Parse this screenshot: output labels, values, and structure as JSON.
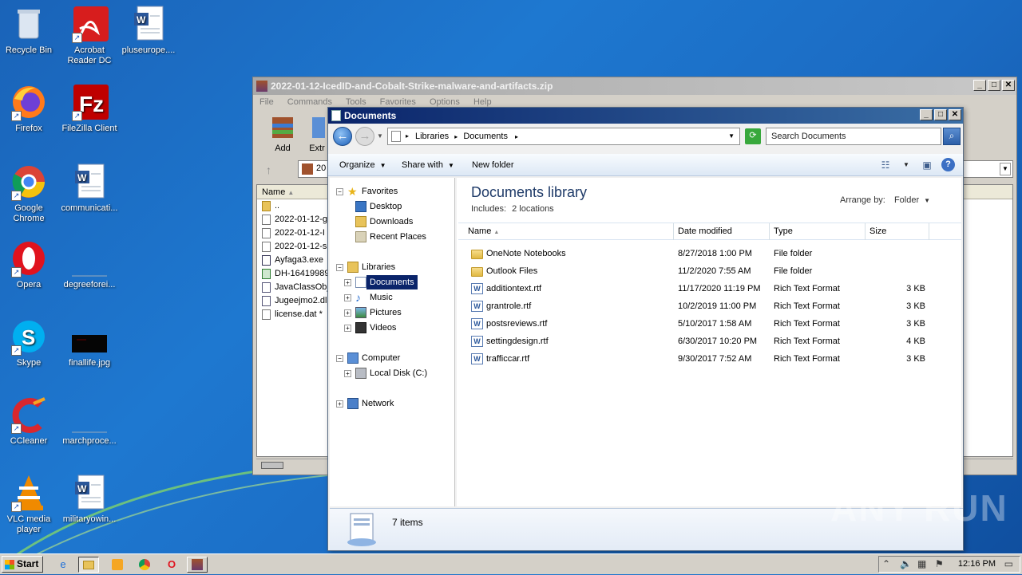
{
  "desktop": {
    "icons": [
      {
        "label": "Recycle Bin",
        "icon": "recycle-bin-icon"
      },
      {
        "label": "Acrobat Reader DC",
        "icon": "acrobat-icon"
      },
      {
        "label": "pluseurope....",
        "icon": "word-doc-icon"
      },
      {
        "label": "Firefox",
        "icon": "firefox-icon"
      },
      {
        "label": "FileZilla Client",
        "icon": "filezilla-icon"
      },
      {
        "label": "Google Chrome",
        "icon": "chrome-icon"
      },
      {
        "label": "communicati...",
        "icon": "word-doc-icon"
      },
      {
        "label": "Opera",
        "icon": "opera-icon"
      },
      {
        "label": "degreeforei...",
        "icon": "blank-file-icon"
      },
      {
        "label": "Skype",
        "icon": "skype-icon"
      },
      {
        "label": "finallife.jpg",
        "icon": "image-file-icon"
      },
      {
        "label": "CCleaner",
        "icon": "ccleaner-icon"
      },
      {
        "label": "marchproce...",
        "icon": "blank-file-icon"
      },
      {
        "label": "VLC media player",
        "icon": "vlc-icon"
      },
      {
        "label": "militaryowin...",
        "icon": "word-doc-icon"
      }
    ]
  },
  "winrar": {
    "title": "2022-01-12-IcedID-and-Cobalt-Strike-malware-and-artifacts.zip",
    "menu": [
      "File",
      "Commands",
      "Tools",
      "Favorites",
      "Options",
      "Help"
    ],
    "toolbar": {
      "add": "Add",
      "extract": "Extr"
    },
    "address": "20",
    "col_name": "Name",
    "rows": [
      "..",
      "2022-01-12-g",
      "2022-01-12-I",
      "2022-01-12-s",
      "Ayfaga3.exe",
      "DH-16419989",
      "JavaClassObj",
      "Jugeejmo2.dl",
      "license.dat *"
    ]
  },
  "explorer": {
    "title": "Documents",
    "breadcrumb": [
      "Libraries",
      "Documents"
    ],
    "search_placeholder": "Search Documents",
    "commands": {
      "organize": "Organize",
      "share": "Share with",
      "new_folder": "New folder"
    },
    "nav": {
      "favorites": "Favorites",
      "desktop": "Desktop",
      "downloads": "Downloads",
      "recent": "Recent Places",
      "libraries": "Libraries",
      "documents": "Documents",
      "music": "Music",
      "pictures": "Pictures",
      "videos": "Videos",
      "computer": "Computer",
      "local_disk": "Local Disk (C:)",
      "network": "Network"
    },
    "library_title": "Documents library",
    "includes": "Includes:",
    "includes_link": "2 locations",
    "arrange_label": "Arrange by:",
    "arrange_value": "Folder",
    "columns": {
      "name": "Name",
      "date": "Date modified",
      "type": "Type",
      "size": "Size"
    },
    "files": [
      {
        "name": "OneNote Notebooks",
        "date": "8/27/2018 1:00 PM",
        "type": "File folder",
        "size": "",
        "kind": "folder"
      },
      {
        "name": "Outlook Files",
        "date": "11/2/2020 7:55 AM",
        "type": "File folder",
        "size": "",
        "kind": "folder"
      },
      {
        "name": "additiontext.rtf",
        "date": "11/17/2020 11:19 PM",
        "type": "Rich Text Format",
        "size": "3 KB",
        "kind": "rtf"
      },
      {
        "name": "grantrole.rtf",
        "date": "10/2/2019 11:00 PM",
        "type": "Rich Text Format",
        "size": "3 KB",
        "kind": "rtf"
      },
      {
        "name": "postsreviews.rtf",
        "date": "5/10/2017 1:58 AM",
        "type": "Rich Text Format",
        "size": "3 KB",
        "kind": "rtf"
      },
      {
        "name": "settingdesign.rtf",
        "date": "6/30/2017 10:20 PM",
        "type": "Rich Text Format",
        "size": "4 KB",
        "kind": "rtf"
      },
      {
        "name": "trafficcar.rtf",
        "date": "9/30/2017 7:52 AM",
        "type": "Rich Text Format",
        "size": "3 KB",
        "kind": "rtf"
      }
    ],
    "item_count": "7 items"
  },
  "taskbar": {
    "start": "Start",
    "clock": "12:16 PM"
  },
  "watermark": "ANY RUN"
}
